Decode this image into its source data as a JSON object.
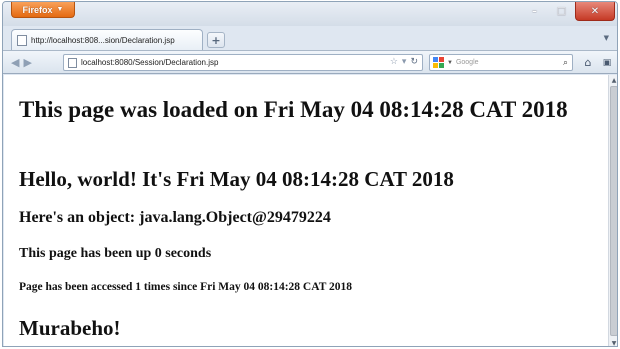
{
  "browser": {
    "app_button_label": "Firefox",
    "tab_title": "http://localhost:808...sion/Declaration.jsp",
    "new_tab_symbol": "+",
    "url": "localhost:8080/Session/Declaration.jsp",
    "search_placeholder": "Google",
    "window_controls": {
      "minimize": "–",
      "maximize": "□",
      "close": "✕"
    }
  },
  "page": {
    "loaded_line": "This page was loaded on Fri May 04 08:14:28 CAT 2018",
    "hello_line": "Hello, world! It's Fri May 04 08:14:28 CAT 2018",
    "object_line": "Here's an object: java.lang.Object@29479224",
    "uptime_line": "This page has been up 0 seconds",
    "access_line": "Page has been accessed 1 times since Fri May 04 08:14:28 CAT 2018",
    "farewell_line": "Murabeho!"
  },
  "colors": {
    "app_button": "#e46a12",
    "close_button": "#c53a26",
    "chrome": "#dfe7f1"
  }
}
